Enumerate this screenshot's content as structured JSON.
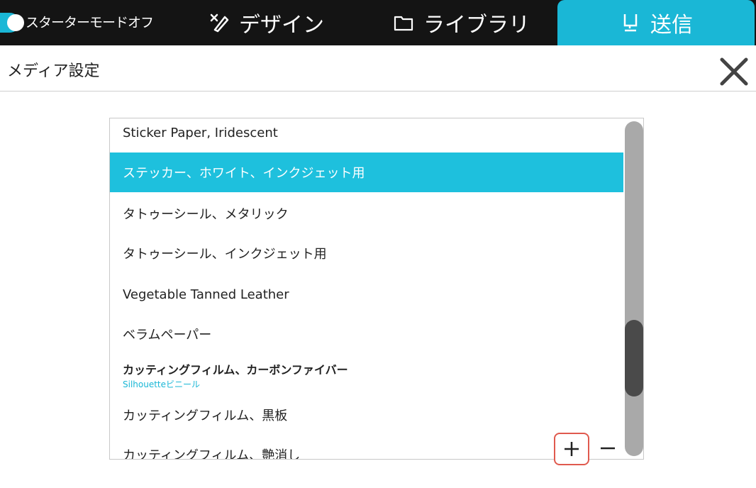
{
  "topbar": {
    "starter_mode_label": "スターターモードオフ",
    "tabs": [
      {
        "label": "デザイン",
        "icon": "design-icon"
      },
      {
        "label": "ライブラリ",
        "icon": "folder-icon"
      },
      {
        "label": "送信",
        "icon": "send-icon",
        "active": true
      }
    ]
  },
  "header": {
    "title": "メディア設定"
  },
  "media_list": {
    "items": [
      {
        "label": "Sticker Paper, Iridescent"
      },
      {
        "label": "ステッカー、ホワイト、インクジェット用",
        "selected": true
      },
      {
        "label": "タトゥーシール、メタリック"
      },
      {
        "label": "タトゥーシール、インクジェット用"
      },
      {
        "label": "Vegetable Tanned Leather"
      },
      {
        "label": "ベラムペーパー"
      },
      {
        "label": "カッティングフィルム、カーボンファイバー",
        "sublabel": "Silhouetteビニール"
      },
      {
        "label": "カッティングフィルム、黒板"
      },
      {
        "label": "カッティングフィルム、艶消し"
      }
    ]
  },
  "colors": {
    "accent": "#1ab7d6",
    "topbar_bg": "#141414",
    "highlight_border": "#e05a4e"
  }
}
